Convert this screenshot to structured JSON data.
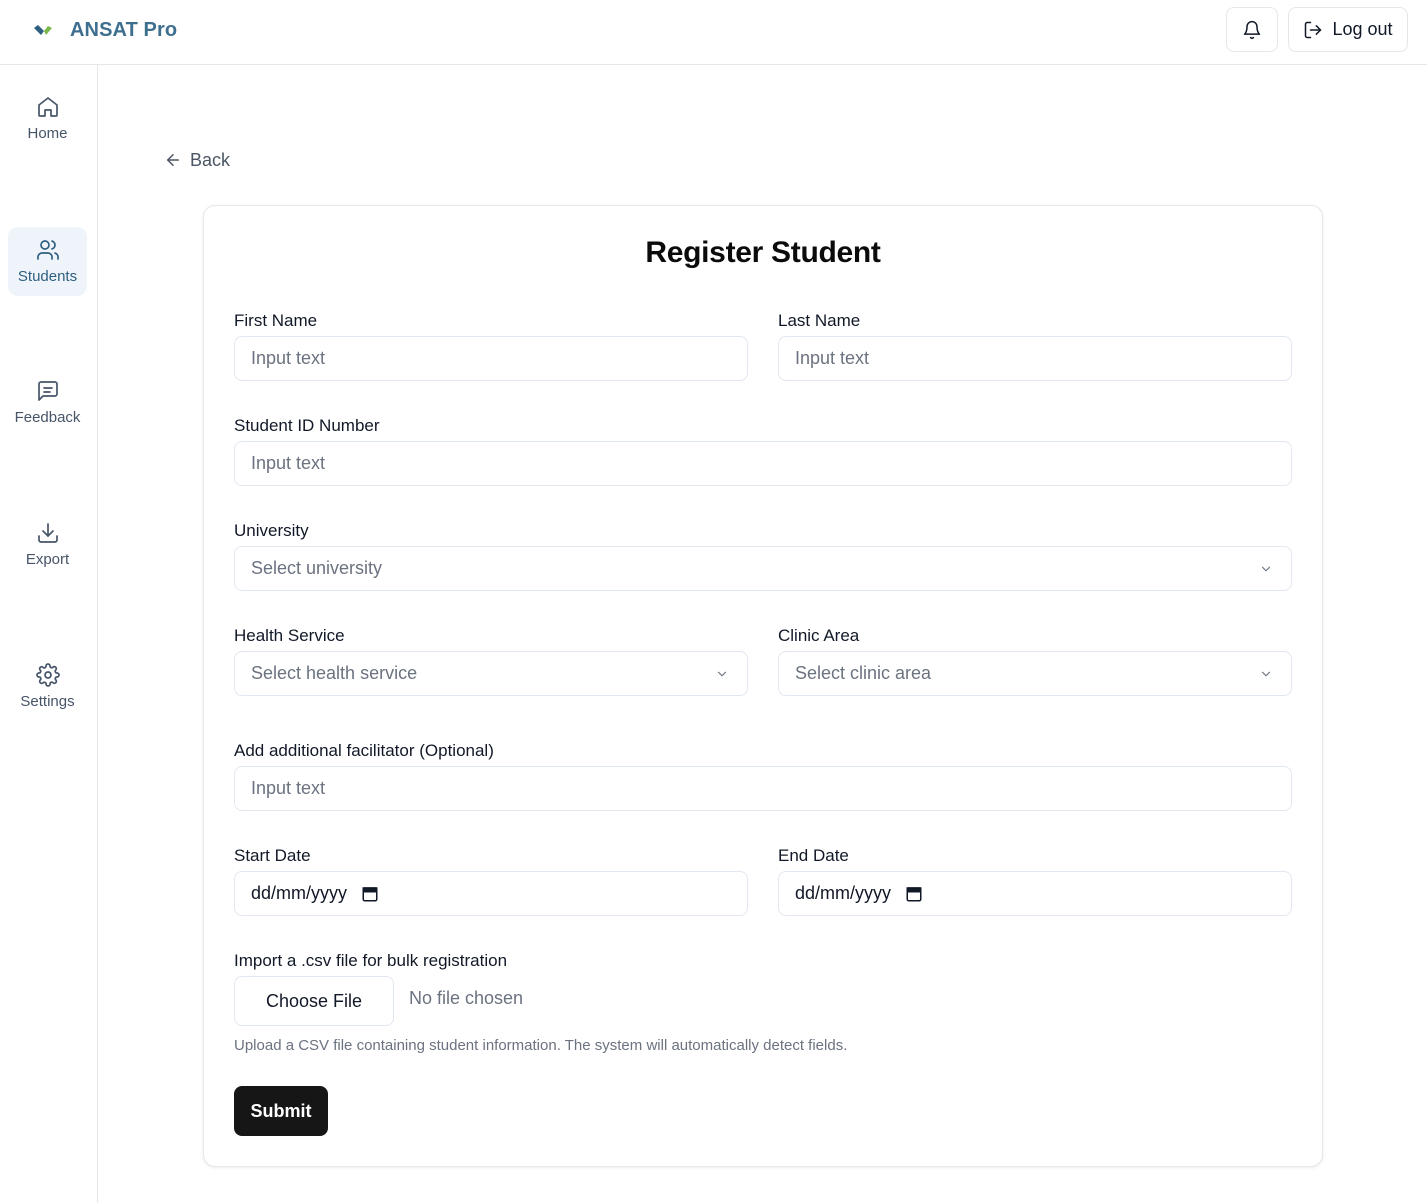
{
  "app": {
    "brand_name": "ANSAT Pro",
    "logout_label": "Log out"
  },
  "sidebar": {
    "items": [
      {
        "label": "Home",
        "icon": "home-icon"
      },
      {
        "label": "Students",
        "icon": "users-icon",
        "active": true
      },
      {
        "label": "Feedback",
        "icon": "message-icon"
      },
      {
        "label": "Export",
        "icon": "download-icon"
      },
      {
        "label": "Settings",
        "icon": "gear-icon"
      }
    ]
  },
  "main": {
    "back_label": "Back",
    "title": "Register Student",
    "fields": {
      "first_name": {
        "label": "First Name",
        "placeholder": "Input text"
      },
      "last_name": {
        "label": "Last Name",
        "placeholder": "Input text"
      },
      "student_id": {
        "label": "Student ID Number",
        "placeholder": "Input text"
      },
      "university": {
        "label": "University",
        "placeholder": "Select university"
      },
      "health_service": {
        "label": "Health Service",
        "placeholder": "Select health service"
      },
      "clinic_area": {
        "label": "Clinic Area",
        "placeholder": "Select clinic area"
      },
      "facilitator": {
        "label": "Add additional facilitator (Optional)",
        "placeholder": "Input text"
      },
      "start_date": {
        "label": "Start Date",
        "value": "dd/mm/yyyy"
      },
      "end_date": {
        "label": "End Date",
        "value": "dd/mm/yyyy"
      }
    },
    "import": {
      "label": "Import a .csv file for bulk registration",
      "choose_file_label": "Choose File",
      "no_file_text": "No file chosen",
      "helper": "Upload a CSV file containing student information. The system will automatically detect fields."
    },
    "submit_label": "Submit"
  },
  "colors": {
    "brand": "#3f6f8f",
    "active_nav_bg": "#eef4fa",
    "submit_bg": "#161616"
  }
}
